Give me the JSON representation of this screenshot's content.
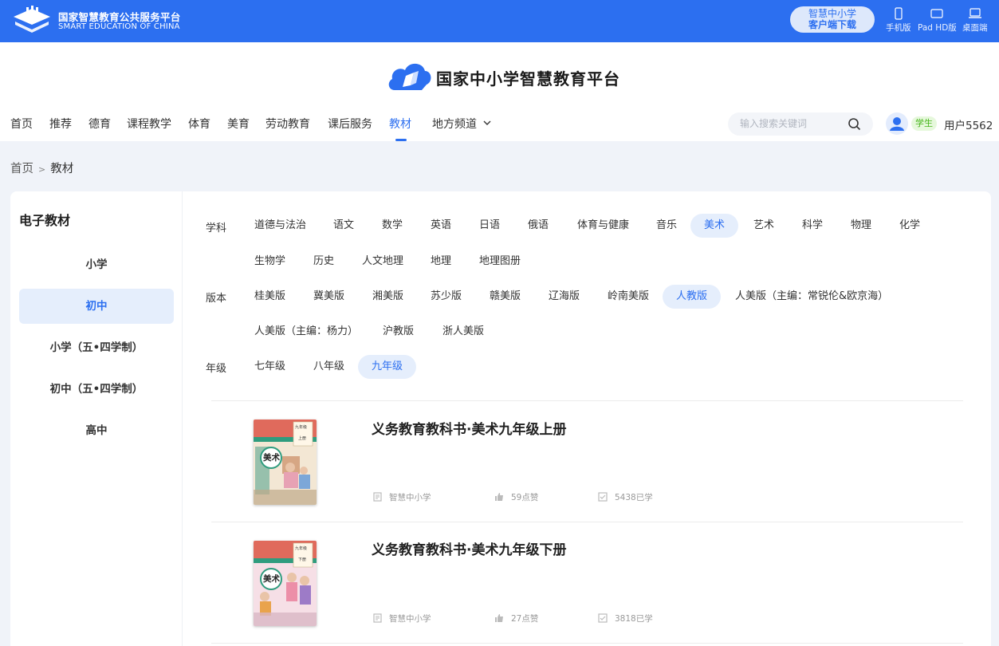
{
  "colors": {
    "primary": "#2c6ff0",
    "active_bg": "#e5eefc",
    "badge_green": "#46b51a"
  },
  "top": {
    "title": "国家智慧教育公共服务平台",
    "subtitle": "SMART EDUCATION OF CHINA",
    "download_line1": "智慧中小学",
    "download_line2": "客户端下载",
    "devices": [
      {
        "label": "手机版",
        "icon": "phone-icon"
      },
      {
        "label": "Pad HD版",
        "icon": "tablet-icon"
      },
      {
        "label": "桌面端",
        "icon": "laptop-icon"
      }
    ]
  },
  "header": {
    "brand": "国家中小学智慧教育平台",
    "nav": [
      "首页",
      "推荐",
      "德育",
      "课程教学",
      "体育",
      "美育",
      "劳动教育",
      "课后服务",
      "教材",
      "地方频道"
    ],
    "nav_active": "教材",
    "search_placeholder": "输入搜索关键词",
    "role": "学生",
    "username": "用户5562"
  },
  "breadcrumb": {
    "home": "首页",
    "separator": ">",
    "current": "教材"
  },
  "sidebar": {
    "title": "电子教材",
    "items": [
      "小学",
      "初中",
      "小学（五•四学制）",
      "初中（五•四学制）",
      "高中"
    ],
    "active": "初中"
  },
  "filters": {
    "subject_label": "学科",
    "subjects": [
      "道德与法治",
      "语文",
      "数学",
      "英语",
      "日语",
      "俄语",
      "体育与健康",
      "音乐",
      "美术",
      "艺术",
      "科学",
      "物理",
      "化学",
      "生物学",
      "历史",
      "人文地理",
      "地理",
      "地理图册"
    ],
    "subject_active": "美术",
    "edition_label": "版本",
    "editions": [
      "桂美版",
      "冀美版",
      "湘美版",
      "苏少版",
      "赣美版",
      "辽海版",
      "岭南美版",
      "人教版",
      "人美版（主编：常锐伦&欧京海）",
      "人美版（主编：杨力）",
      "沪教版",
      "浙人美版"
    ],
    "edition_active": "人教版",
    "grade_label": "年级",
    "grades": [
      "七年级",
      "八年级",
      "九年级"
    ],
    "grade_active": "九年级"
  },
  "books": [
    {
      "title": "义务教育教科书·美术九年级上册",
      "publisher": "智慧中小学",
      "likes": "59点赞",
      "learners": "5438已学",
      "cover_subject": "美术",
      "cover_grade": "九年级",
      "cover_vol": "上册",
      "cover_top": "#e06a5c",
      "cover_band": "#2f9c7e"
    },
    {
      "title": "义务教育教科书·美术九年级下册",
      "publisher": "智慧中小学",
      "likes": "27点赞",
      "learners": "3818已学",
      "cover_subject": "美术",
      "cover_grade": "九年级",
      "cover_vol": "下册",
      "cover_top": "#e06a5c",
      "cover_band": "#2f9c7e"
    }
  ]
}
